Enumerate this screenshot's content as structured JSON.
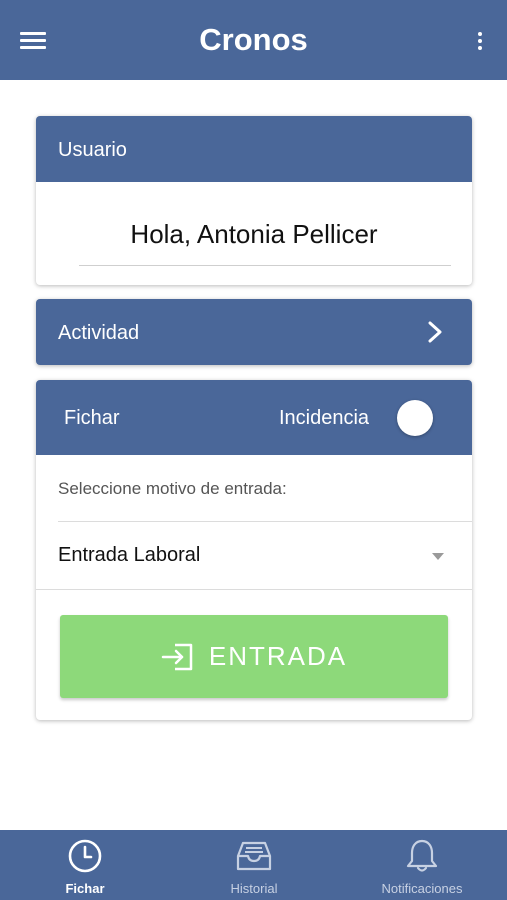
{
  "header": {
    "title": "Cronos",
    "menu_icon": "hamburger-menu-icon",
    "more_icon": "more-vertical-icon"
  },
  "usuario_card": {
    "title": "Usuario",
    "greeting": "Hola, Antonia Pellicer"
  },
  "actividad_card": {
    "title": "Actividad",
    "icon": "chevron-right-icon"
  },
  "fichar_card": {
    "title": "Fichar",
    "incidencia_label": "Incidencia",
    "incidencia_enabled": false,
    "select_prompt": "Seleccione motivo de entrada:",
    "selected_reason": "Entrada Laboral",
    "action_button": {
      "label": "ENTRADA",
      "icon": "login-arrow-icon"
    }
  },
  "bottom_nav": {
    "items": [
      {
        "label": "Fichar",
        "icon": "clock-icon",
        "active": true
      },
      {
        "label": "Historial",
        "icon": "inbox-tray-icon",
        "active": false
      },
      {
        "label": "Notificaciones",
        "icon": "bell-icon",
        "active": false
      }
    ]
  },
  "colors": {
    "primary": "#4a6799",
    "success": "#8dd97a",
    "nav_inactive": "#c7d1e3",
    "background": "#ffffff"
  }
}
